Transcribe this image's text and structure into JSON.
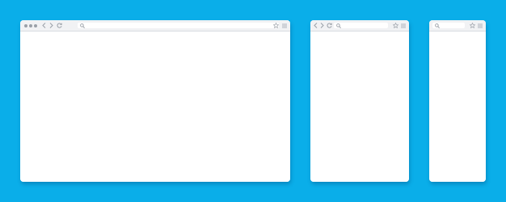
{
  "background_color": "#0aaee9",
  "windows": [
    {
      "name": "browser-window-desktop",
      "has_traffic_dots": true,
      "has_nav": true
    },
    {
      "name": "browser-window-tablet",
      "has_traffic_dots": false,
      "has_nav": true
    },
    {
      "name": "browser-window-mobile",
      "has_traffic_dots": false,
      "has_nav": false
    }
  ],
  "icons": {
    "back": "chevron-left-icon",
    "forward": "chevron-right-icon",
    "reload": "reload-icon",
    "search": "search-icon",
    "bookmark": "star-icon",
    "menu": "hamburger-menu-icon"
  },
  "colors": {
    "toolbar": "#f1f2f4",
    "icon": "#9aa0a8",
    "window": "#ffffff"
  }
}
